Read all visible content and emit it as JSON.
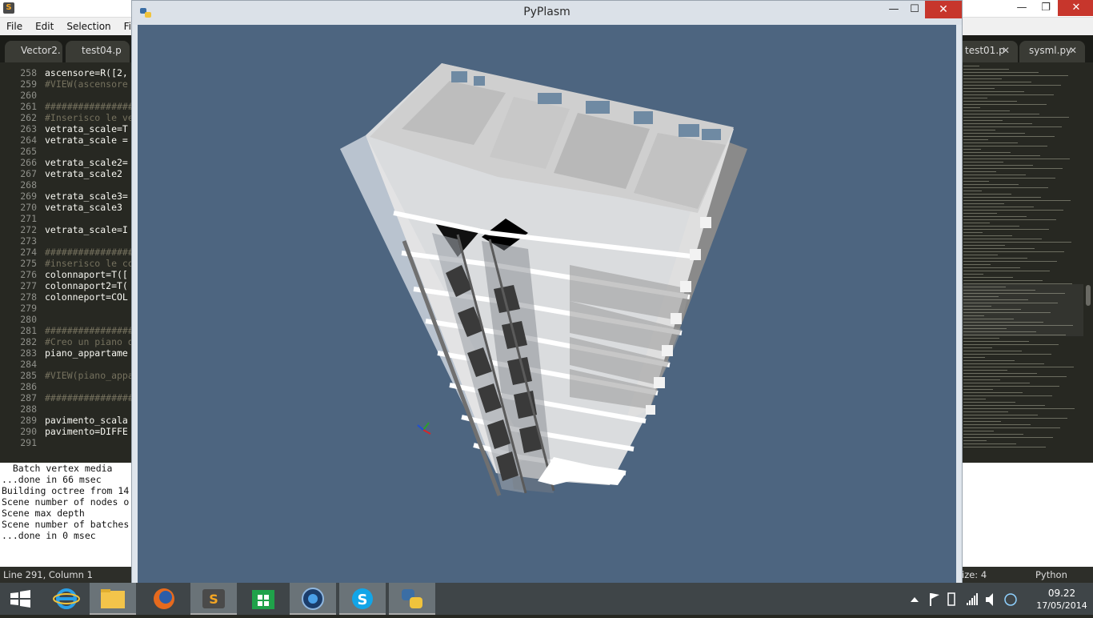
{
  "editor": {
    "menu": [
      "File",
      "Edit",
      "Selection",
      "Find"
    ],
    "tabs": [
      {
        "label": "Vector2."
      },
      {
        "label": "test04.p"
      },
      {
        "label": "test01.p"
      },
      {
        "label": "sysml.py"
      }
    ],
    "line_numbers": [
      "258",
      "259",
      "260",
      "261",
      "262",
      "263",
      "264",
      "265",
      "266",
      "267",
      "268",
      "269",
      "270",
      "271",
      "272",
      "273",
      "274",
      "275",
      "276",
      "277",
      "278",
      "279",
      "280",
      "281",
      "282",
      "283",
      "284",
      "285",
      "286",
      "287",
      "288",
      "289",
      "290",
      "291"
    ],
    "code_lines": [
      "ascensore=R([2,",
      "#VIEW(ascensore",
      "",
      "################",
      "#Inserisco le ve",
      "vetrata_scale=T",
      "vetrata_scale =",
      "",
      "vetrata_scale2=",
      "vetrata_scale2 ",
      "",
      "vetrata_scale3=",
      "vetrata_scale3 ",
      "",
      "vetrata_scale=I",
      "",
      "################",
      "#inserisco le co",
      "colonnaport=T([",
      "colonnaport2=T(",
      "colonneport=COL",
      "",
      "",
      "################",
      "#Creo un piano d",
      "piano_appartame",
      "",
      "#VIEW(piano_appa",
      "",
      "################",
      "",
      "pavimento_scala",
      "pavimento=DIFFE",
      ""
    ],
    "console_lines": [
      "  Batch vertex media",
      "...done in 66 msec",
      "Building octree from 14",
      "Scene number of nodes o",
      "Scene max depth",
      "Scene number of batches",
      "...done in 0 msec"
    ],
    "status_left": "Line 291, Column 1",
    "status_mid": "ize: 4",
    "status_right": "Python"
  },
  "pyplasm": {
    "title": "PyPlasm",
    "min": "—",
    "max": "☐",
    "close": "✕"
  },
  "taskbar": {
    "items": [
      "start-button",
      "internet-explorer",
      "file-explorer",
      "firefox",
      "sublime-text",
      "windows-store",
      "media-app",
      "skype",
      "python"
    ],
    "time": "09.22",
    "date": "17/05/2014"
  }
}
